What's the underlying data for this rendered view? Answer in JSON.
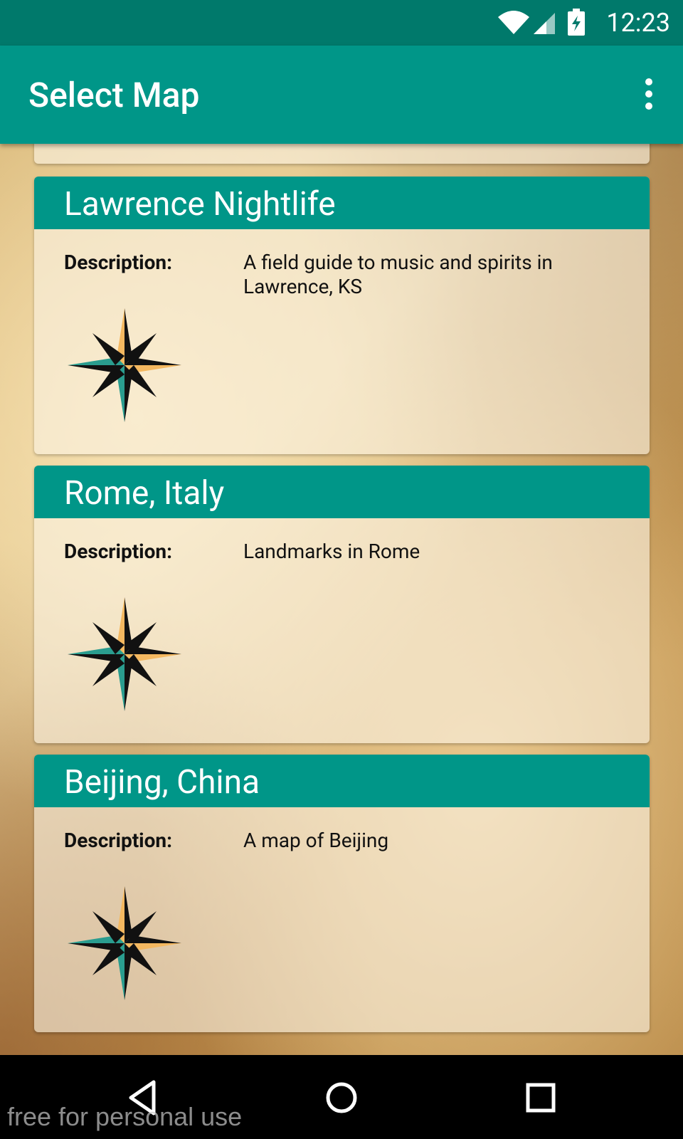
{
  "status_bar": {
    "time": "12:23"
  },
  "app_bar": {
    "title": "Select Map",
    "menu_icon": "overflow-menu-icon"
  },
  "maps": [
    {
      "title": "Lawrence Nightlife",
      "description_label": "Description:",
      "description": "A field guide to music and spirits in Lawrence, KS"
    },
    {
      "title": "Rome, Italy",
      "description_label": "Description:",
      "description": "Landmarks in Rome"
    },
    {
      "title": "Beijing, China",
      "description_label": "Description:",
      "description": "A map of Beijing"
    }
  ],
  "nav": {
    "back_icon": "back-icon",
    "home_icon": "home-icon",
    "recents_icon": "recents-icon"
  },
  "watermark": "free for personal use",
  "colors": {
    "primary": "#009688",
    "primary_dark": "#00796b",
    "compass_teal": "#2a9d8f",
    "compass_gold": "#f4b860"
  }
}
